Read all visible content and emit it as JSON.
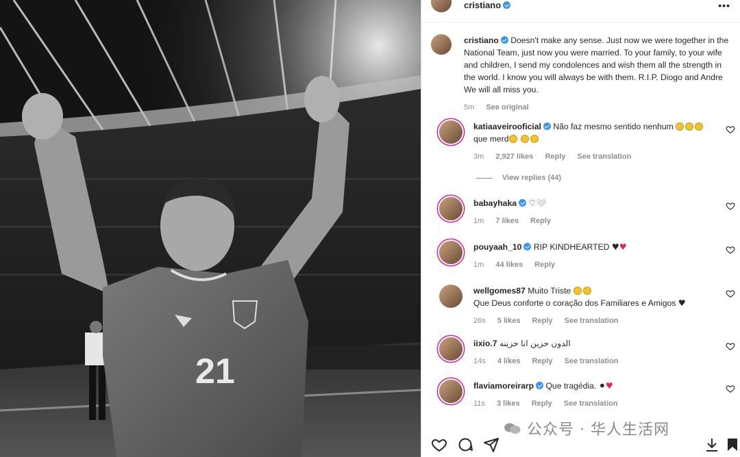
{
  "header": {
    "username": "cristiano",
    "more_label": "•••"
  },
  "caption": {
    "username": "cristiano",
    "text": "Doesn't make any sense. Just now we were together in the National Team, just now you were married. To your family, to your wife and children, I send my condolences and wish them all the strength in the world. I know you will always be with them. R.I.P. Diogo and Andre We will all miss you.",
    "time": "5m",
    "see_original": "See original"
  },
  "comments": [
    {
      "username": "katiaaveirooficial",
      "verified": true,
      "text_a": "Não faz mesmo sentido nenhum",
      "text_b": "que merd",
      "time": "3m",
      "likes": "2,927 likes",
      "reply": "Reply",
      "translation": "See translation"
    },
    {
      "username": "babayhaka",
      "verified": true,
      "text": "♡🤍",
      "time": "1m",
      "likes": "7 likes",
      "reply": "Reply"
    },
    {
      "username": "pouyaah_10",
      "verified": true,
      "text": "RIP KINDHEARTED",
      "time": "1m",
      "likes": "44 likes",
      "reply": "Reply"
    },
    {
      "username": "wellgomes87",
      "text_a": "Muito Triste",
      "text_b": "Que Deus conforte o coração dos Familiares e Amigos",
      "time": "26s",
      "likes": "5 likes",
      "reply": "Reply",
      "translation": "See translation"
    },
    {
      "username": "iixio.7",
      "text": "الدون حزين انا حزينه",
      "time": "14s",
      "likes": "4 likes",
      "reply": "Reply",
      "translation": "See translation"
    },
    {
      "username": "flaviamoreirarp",
      "verified": true,
      "text": "Que tragédia.",
      "time": "11s",
      "likes": "3 likes",
      "reply": "Reply",
      "translation": "See translation"
    }
  ],
  "view_replies": "View replies (44)",
  "photo": {
    "jersey_number": "21"
  },
  "watermark": "公众号 · 华人生活网",
  "icons": [
    "heart-icon",
    "comment-icon",
    "share-icon",
    "download-icon",
    "bookmark-icon"
  ]
}
